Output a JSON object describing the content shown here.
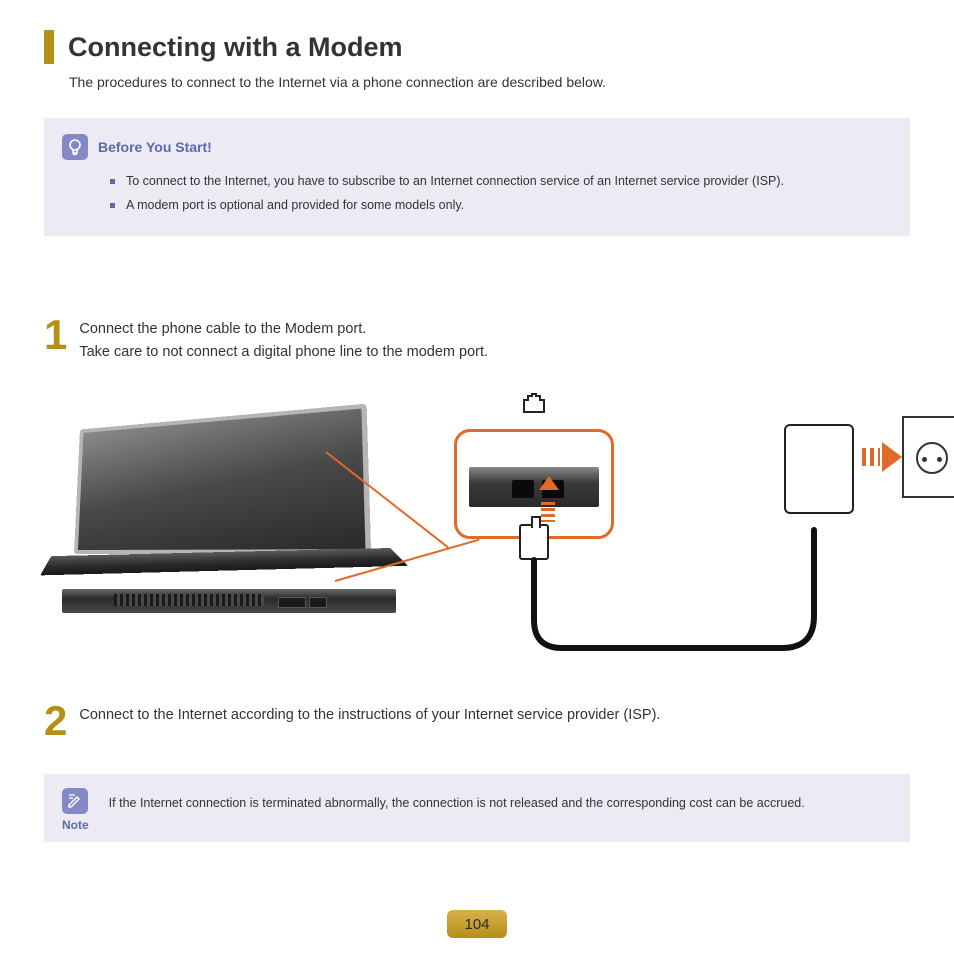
{
  "title": "Connecting with a Modem",
  "subtitle": "The procedures to connect to the Internet via a phone connection are described below.",
  "before": {
    "heading": "Before You Start!",
    "items": [
      "To connect to the Internet, you have to subscribe to an Internet connection service of an Internet service provider (ISP).",
      "A modem port is optional and provided for some models only."
    ]
  },
  "steps": {
    "one": {
      "num": "1",
      "line1": "Connect the phone cable to the Modem port.",
      "line2": "Take care to not connect a digital phone line to the modem port."
    },
    "two": {
      "num": "2",
      "text": "Connect to the Internet according to the instructions of your Internet service provider (ISP)."
    }
  },
  "note": {
    "label": "Note",
    "text": "If the Internet connection is terminated abnormally, the connection is not released and the corresponding cost can be accrued."
  },
  "page_number": "104",
  "colors": {
    "accent_gold": "#b69016",
    "accent_blue": "#5a6aad",
    "highlight_orange": "#e06a28",
    "callout_bg": "#edeaf3"
  }
}
